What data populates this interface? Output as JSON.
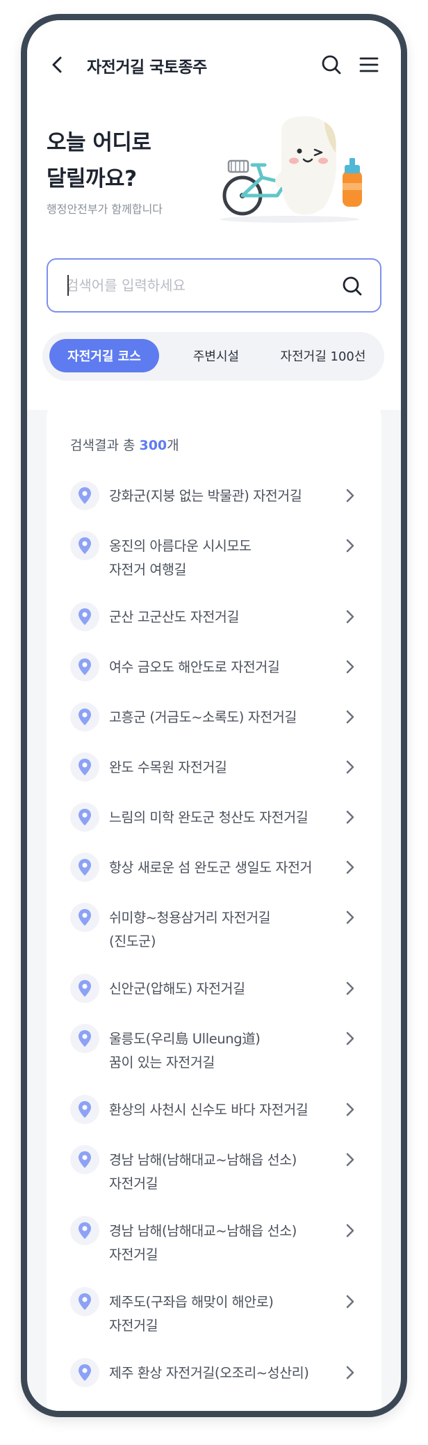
{
  "header": {
    "title": "자전거길 국토종주"
  },
  "hero": {
    "title_line1": "오늘 어디로",
    "title_line2": "달릴까요?",
    "subtitle": "행정안전부가 함께합니다"
  },
  "search": {
    "placeholder": "검색어를 입력하세요",
    "value": ""
  },
  "tabs": [
    {
      "label": "자전거길 코스",
      "active": true
    },
    {
      "label": "주변시설",
      "active": false
    },
    {
      "label": "자전거길 100선",
      "active": false
    }
  ],
  "results": {
    "prefix": "검색결과 총 ",
    "count": "300",
    "suffix": "개"
  },
  "courses": [
    "강화군(지붕 없는 박물관) 자전거길",
    "옹진의 아름다운 시시모도\n자전거 여행길",
    "군산 고군산도 자전거길",
    "여수 금오도 해안도로 자전거길",
    "고흥군 (거금도~소록도) 자전거길",
    "완도 수목원 자전거길",
    "느림의 미학 완도군 청산도 자전거길",
    "항상 새로운 섬 완도군 생일도 자전거",
    "쉬미향~청용삼거리 자전거길\n(진도군)",
    "신안군(압해도) 자전거길",
    "울릉도(우리島 Ulleung道)\n꿈이 있는 자전거길",
    "환상의 사천시 신수도 바다 자전거길",
    "경남 남해(남해대교~남해읍 선소)\n자전거길",
    "경남 남해(남해대교~남해읍 선소)\n자전거길",
    "제주도(구좌읍 해맞이 해안로)\n자전거길",
    "제주 환상 자전거길(오조리~성산리)"
  ],
  "colors": {
    "accent": "#5e7bf0",
    "frame": "#3c4756",
    "pin": "#8da2f5"
  },
  "icons": {
    "back": "chevron-left-icon",
    "search": "search-icon",
    "menu": "hamburger-icon",
    "pin": "location-pin-icon",
    "chevron": "chevron-right-icon"
  }
}
